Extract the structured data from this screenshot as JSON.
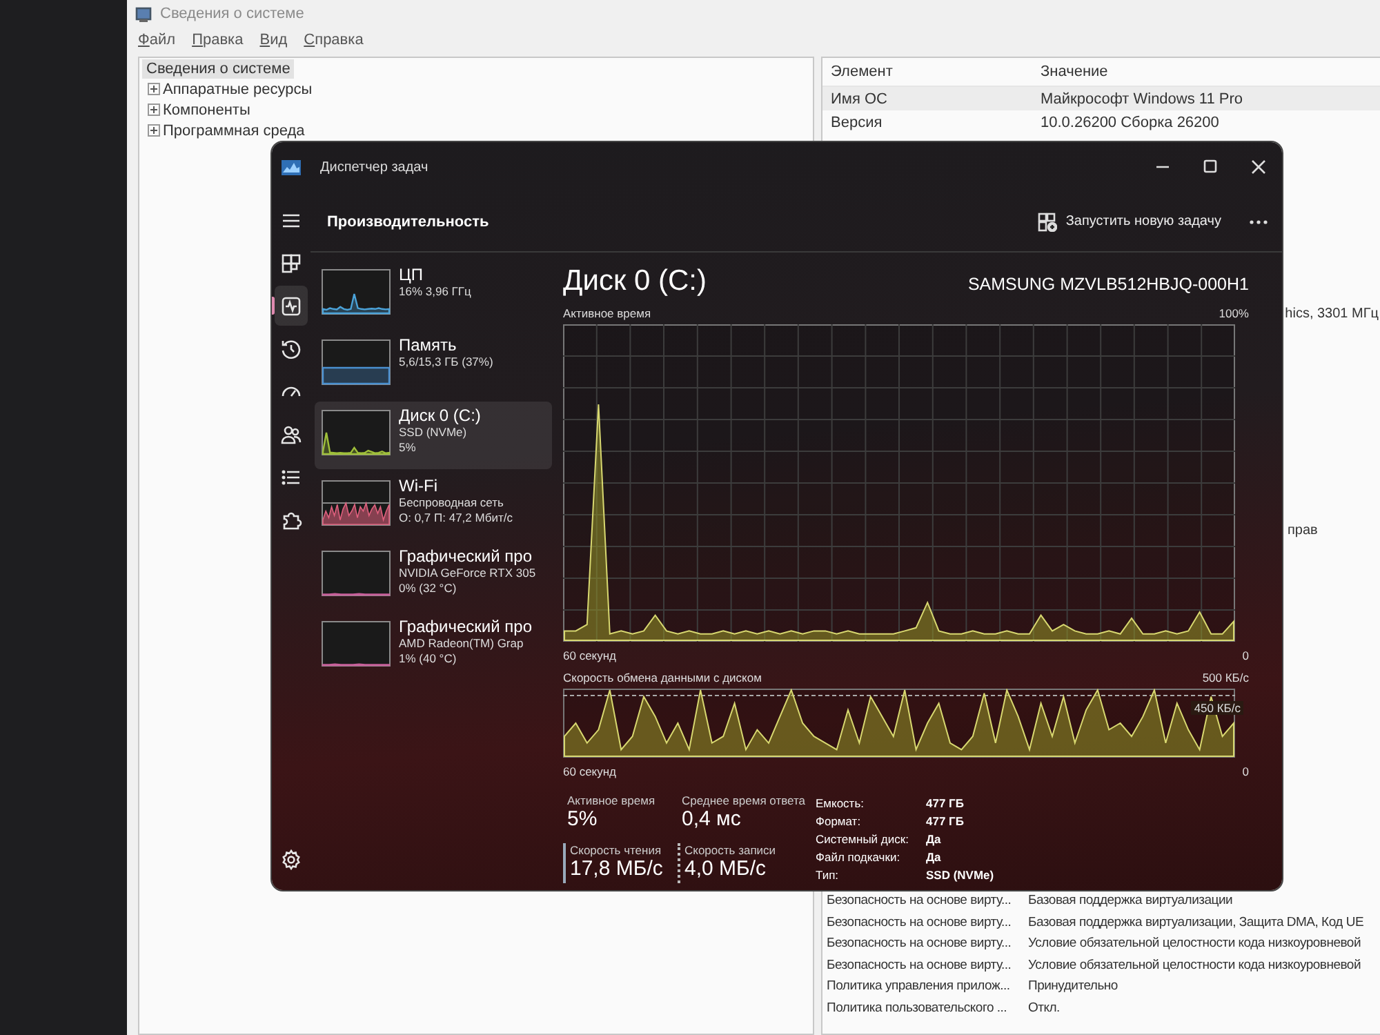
{
  "system_info": {
    "title": "Сведения о системе",
    "menu": [
      "Файл",
      "Правка",
      "Вид",
      "Справка"
    ],
    "tree": [
      {
        "label": "Сведения о системе",
        "selected": true,
        "children": [
          {
            "label": "Аппаратные ресурсы",
            "expanded": false
          },
          {
            "label": "Компоненты",
            "expanded": false
          },
          {
            "label": "Программная среда",
            "expanded": false
          }
        ]
      }
    ],
    "columns": [
      "Элемент",
      "Значение"
    ],
    "rows_top": [
      {
        "item": "Имя ОС",
        "value": "Майкрософт Windows 11 Pro"
      },
      {
        "item": "Версия",
        "value": "10.0.26200 Сборка 26200"
      }
    ],
    "value_fragments": [
      "hics, 3301 МГц",
      "прав"
    ],
    "rows_bottom": [
      {
        "item": "Безопасность на основе вирту...",
        "value": "Базовая поддержка виртуализации"
      },
      {
        "item": "Безопасность на основе вирту...",
        "value": "Базовая поддержка виртуализации, Защита DMA, Код UE"
      },
      {
        "item": "Безопасность на основе вирту...",
        "value": "Условие обязательной целостности кода низкоуровневой"
      },
      {
        "item": "Безопасность на основе вирту...",
        "value": "Условие обязательной целостности кода низкоуровневой"
      },
      {
        "item": "Политика управления прилож...",
        "value": "Принудительно"
      },
      {
        "item": "Политика пользовательского ...",
        "value": "Откл."
      }
    ]
  },
  "task_manager": {
    "title": "Диспетчер задач",
    "nav": [
      {
        "kind": "menu",
        "selected": false
      },
      {
        "kind": "processes",
        "selected": false
      },
      {
        "kind": "performance",
        "selected": true
      },
      {
        "kind": "history",
        "selected": false
      },
      {
        "kind": "startup",
        "selected": false
      },
      {
        "kind": "users",
        "selected": false
      },
      {
        "kind": "details",
        "selected": false
      },
      {
        "kind": "services",
        "selected": false
      },
      {
        "kind": "settings",
        "selected": false
      }
    ],
    "page_title": "Производительность",
    "new_task": "Запустить новую задачу",
    "devices": [
      {
        "kind": "cpu",
        "name": "ЦП",
        "detail": [
          "16% 3,96 ГГц"
        ],
        "color": "#4ba3d9",
        "selected": false
      },
      {
        "kind": "memory",
        "name": "Память",
        "detail": [
          "5,6/15,3 ГБ (37%)"
        ],
        "color": "#4a90d0",
        "selected": false
      },
      {
        "kind": "disk",
        "name": "Диск 0 (C:)",
        "detail": [
          "SSD (NVMe)",
          "5%"
        ],
        "color": "#9fbf3a",
        "selected": true
      },
      {
        "kind": "network",
        "name": "Wi-Fi",
        "detail": [
          "Беспроводная сеть",
          "О: 0,7 П: 47,2 Мбит/с"
        ],
        "color": "#e0607e",
        "selected": false
      },
      {
        "kind": "gpu",
        "name": "Графический про",
        "detail": [
          "NVIDIA GeForce RTX 305",
          "0% (32 °C)"
        ],
        "color": "#c8609a",
        "selected": false
      },
      {
        "kind": "gpu",
        "name": "Графический про",
        "detail": [
          "AMD Radeon(TM) Grap",
          "1% (40 °C)"
        ],
        "color": "#c8609a",
        "selected": false
      }
    ],
    "main": {
      "title": "Диск 0 (C:)",
      "model": "SAMSUNG MZVLB512HBJQ-000H1",
      "charts": [
        {
          "kind": "active_time",
          "label": "Активное время",
          "max": "100%",
          "time": "60 секунд",
          "min": "0"
        },
        {
          "kind": "transfer",
          "label": "Скорость обмена данными с диском",
          "max": "500 КБ/с",
          "marker": "450 КБ/с",
          "time": "60 секунд",
          "min": "0"
        }
      ],
      "stats": [
        {
          "kind": "plain",
          "label": "Активное время",
          "value": "5%"
        },
        {
          "kind": "plain",
          "label": "Среднее время ответа",
          "value": "0,4 мс"
        },
        {
          "kind": "read",
          "label": "Скорость чтения",
          "value": "17,8 МБ/с"
        },
        {
          "kind": "write",
          "label": "Скорость записи",
          "value": "4,0 МБ/с"
        }
      ],
      "properties": [
        {
          "label": "Емкость:",
          "value": "477 ГБ"
        },
        {
          "label": "Формат:",
          "value": "477 ГБ"
        },
        {
          "label": "Системный диск:",
          "value": "Да"
        },
        {
          "label": "Файл подкачки:",
          "value": "Да"
        },
        {
          "label": "Тип:",
          "value": "SSD (NVMe)"
        }
      ]
    }
  }
}
